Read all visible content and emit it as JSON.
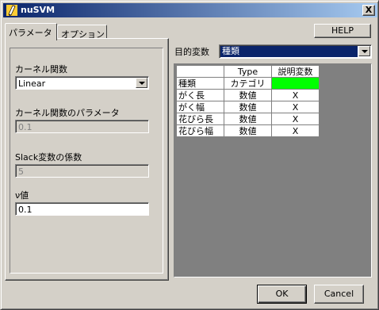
{
  "window": {
    "title": "nuSVM",
    "close_glyph": "X"
  },
  "tabs": [
    {
      "label": "パラメータ",
      "active": true
    },
    {
      "label": "オプション",
      "active": false
    }
  ],
  "help_label": "HELP",
  "params": {
    "kernel_label": "カーネル関数",
    "kernel_value": "Linear",
    "kernel_param_label": "カーネル関数のパラメータ",
    "kernel_param_value": "0.1",
    "slack_label": "Slack変数の係数",
    "slack_value": "5",
    "nu_label": "ν値",
    "nu_value": "0.1"
  },
  "target": {
    "label": "目的変数",
    "value": "種類"
  },
  "grid": {
    "headers": [
      "",
      "Type",
      "説明変数"
    ],
    "rows": [
      {
        "name": "種類",
        "type": "カテゴリ",
        "explanatory": "",
        "highlight": true
      },
      {
        "name": "がく長",
        "type": "数値",
        "explanatory": "X",
        "highlight": false
      },
      {
        "name": "がく幅",
        "type": "数値",
        "explanatory": "X",
        "highlight": false
      },
      {
        "name": "花びら長",
        "type": "数値",
        "explanatory": "X",
        "highlight": false
      },
      {
        "name": "花びら幅",
        "type": "数値",
        "explanatory": "X",
        "highlight": false
      }
    ]
  },
  "buttons": {
    "ok": "OK",
    "cancel": "Cancel"
  },
  "colors": {
    "highlight_cell": "#00ff00",
    "selection": "#0a246a",
    "face": "#d4d0c8"
  },
  "icons": {
    "app": "pencil-icon",
    "close": "close-icon",
    "dropdown": "chevron-down-icon"
  }
}
